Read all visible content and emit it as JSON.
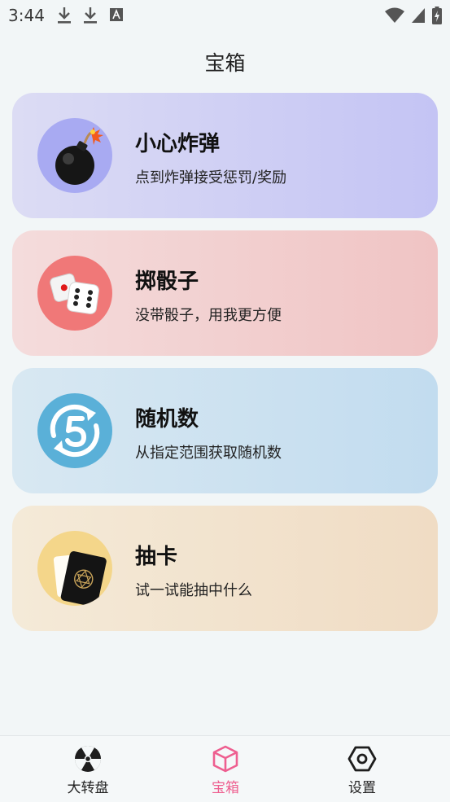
{
  "status_bar": {
    "time": "3:44"
  },
  "header": {
    "title": "宝箱"
  },
  "cards": [
    {
      "title": "小心炸弹",
      "subtitle": "点到炸弹接受惩罚/奖励",
      "icon": "bomb-icon",
      "bg_from": "#dcdcf4",
      "bg_to": "#c4c4f4",
      "icon_bg": "#a8aaf2"
    },
    {
      "title": "掷骰子",
      "subtitle": "没带骰子，用我更方便",
      "icon": "dice-icon",
      "bg_from": "#f4dcdc",
      "bg_to": "#f0c4c4",
      "icon_bg": "#f07878"
    },
    {
      "title": "随机数",
      "subtitle": "从指定范围获取随机数",
      "icon": "number-five-icon",
      "bg_from": "#d8e8f2",
      "bg_to": "#c2dcef",
      "icon_bg": "#5ab0d8"
    },
    {
      "title": "抽卡",
      "subtitle": "试一试能抽中什么",
      "icon": "card-icon",
      "bg_from": "#f4ead8",
      "bg_to": "#f0dcc4",
      "icon_bg": "#f4d68a"
    }
  ],
  "tab_bar": {
    "tabs": [
      {
        "label": "大转盘",
        "icon": "wheel-icon",
        "active": false
      },
      {
        "label": "宝箱",
        "icon": "box-icon",
        "active": true
      },
      {
        "label": "设置",
        "icon": "hexagon-settings-icon",
        "active": false
      }
    ],
    "active_color": "#ee5f90"
  }
}
